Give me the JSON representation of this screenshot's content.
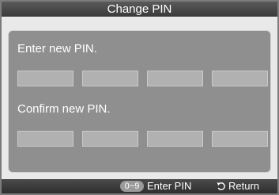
{
  "title": "Change PIN",
  "new_pin": {
    "label": "Enter new PIN.",
    "digit_count": 4
  },
  "confirm_pin": {
    "label": "Confirm new PIN.",
    "digit_count": 4
  },
  "footer": {
    "digit_key": "0~9",
    "enter_label": "Enter PIN",
    "return_icon": "return-arrow-icon",
    "return_label": "Return"
  }
}
